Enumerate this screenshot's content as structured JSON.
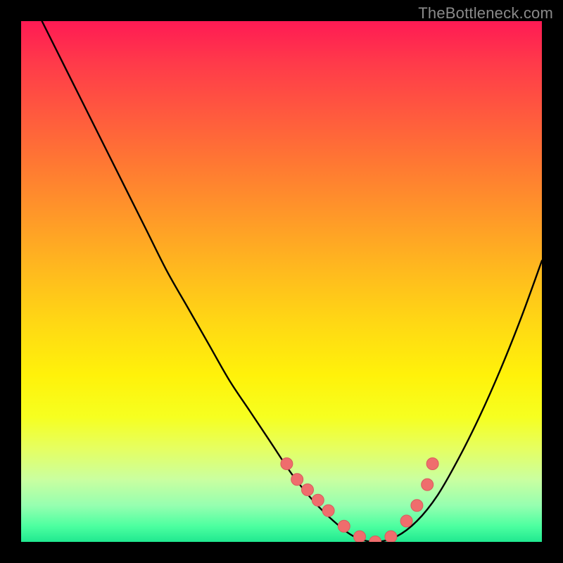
{
  "watermark": "TheBottleneck.com",
  "colors": {
    "background": "#000000",
    "curve_stroke": "#000000",
    "dot_fill": "#ef6d6d",
    "dot_stroke": "#d85c5c",
    "watermark": "#8a8a8a"
  },
  "chart_data": {
    "type": "line",
    "title": "",
    "xlabel": "",
    "ylabel": "",
    "xlim": [
      0,
      100
    ],
    "ylim": [
      0,
      100
    ],
    "grid": false,
    "legend": null,
    "series": [
      {
        "name": "bottleneck-curve",
        "x": [
          4,
          8,
          12,
          16,
          20,
          24,
          28,
          32,
          36,
          40,
          44,
          48,
          52,
          56,
          60,
          64,
          68,
          72,
          76,
          80,
          84,
          88,
          92,
          96,
          100
        ],
        "y": [
          100,
          92,
          84,
          76,
          68,
          60,
          52,
          45,
          38,
          31,
          25,
          19,
          13,
          8,
          4,
          1,
          0,
          1,
          4,
          9,
          16,
          24,
          33,
          43,
          54
        ]
      }
    ],
    "markers": {
      "name": "highlight-dots",
      "x": [
        51,
        53,
        55,
        57,
        59,
        62,
        65,
        68,
        71,
        74,
        76,
        78,
        79
      ],
      "y": [
        15,
        12,
        10,
        8,
        6,
        3,
        1,
        0,
        1,
        4,
        7,
        11,
        15
      ]
    },
    "gradient_note": "vertical red-yellow-green gradient maps to y-axis (high=red=bottleneck, low=green=balanced)"
  }
}
